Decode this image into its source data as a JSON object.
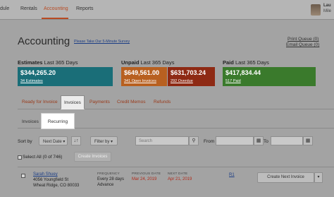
{
  "nav": {
    "items": [
      "dule",
      "Rentals",
      "Accounting",
      "Reports"
    ],
    "user_name": "Lau",
    "user_sub": "Mile"
  },
  "header": {
    "title": "Accounting",
    "survey_link": "Please Take Our 5-Minute Survey",
    "print_queue": "Print Queue (0)",
    "email_queue": "Email Queue (0)"
  },
  "stats": {
    "estimates": {
      "title_bold": "Estimates",
      "title_rest": "Last 365 Days",
      "amount": "$344,265.20",
      "sub": "34 Estimates",
      "color": "#1a6e78"
    },
    "unpaid": {
      "title_bold": "Unpaid",
      "title_rest": "Last 365 Days",
      "open_amount": "$649,561.00",
      "open_sub": "341 Open Invoices",
      "open_color": "#b86020",
      "overdue_amount": "$631,703.24",
      "overdue_sub": "292 Overdue",
      "overdue_color": "#8e2a14"
    },
    "paid": {
      "title_bold": "Paid",
      "title_rest": "Last 365 Days",
      "amount": "$417,834.44",
      "sub": "517 Paid",
      "color": "#3a7a2c"
    }
  },
  "tabs": [
    "Ready for Invoice",
    "Invoices",
    "Payments",
    "Credit Memos",
    "Refunds"
  ],
  "active_tab": "Invoices",
  "subtabs": [
    "Invoices",
    "Recurring"
  ],
  "active_subtab": "Recurring",
  "filters": {
    "sort_by_label": "Sort by",
    "sort_value": "Next Date ▾",
    "sort_order_icon": "↓↑",
    "filter_by": "Filter by ▾",
    "search_placeholder": "Search",
    "from_label": "From",
    "to_label": "To",
    "calendar_icon": "▦",
    "select_all": "Select All (0 of 746)",
    "create_invoices": "Create Invoices"
  },
  "row": {
    "name": "Sarah Shuey",
    "address1": "4056 Youngfield St",
    "address2": "Wheat Ridge, CO 80033",
    "frequency_label": "FREQUENCY",
    "frequency_line1": "Every 28 days",
    "frequency_line2": "Advance",
    "previous_label": "PREVIOUS DATE",
    "previous_date": "Mar 24, 2019",
    "next_label": "NEXT DATE",
    "next_date": "Apr 21, 2019",
    "ref": "R1",
    "action": "Create Next Invoice",
    "caret": "▾"
  }
}
